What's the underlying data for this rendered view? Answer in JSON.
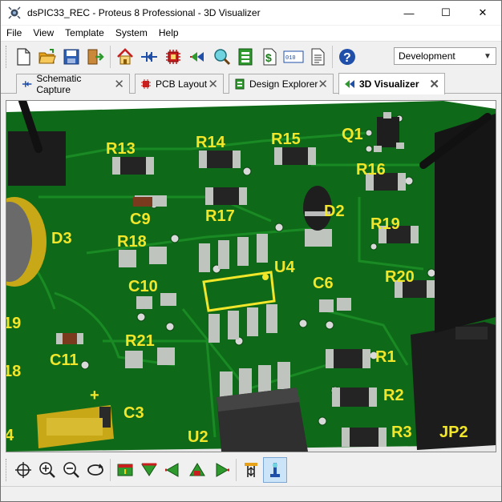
{
  "window": {
    "title": "dsPIC33_REC - Proteus 8 Professional - 3D Visualizer",
    "controls": {
      "minimize": "—",
      "maximize": "☐",
      "close": "✕"
    }
  },
  "menu": [
    "File",
    "View",
    "Template",
    "System",
    "Help"
  ],
  "toolbar": {
    "buttons": [
      "new-file-icon",
      "open-folder-icon",
      "save-icon",
      "close-project-icon",
      "home-icon",
      "schematic-icon",
      "pcb-layout-icon",
      "gerber-icon",
      "design-explorer-icon",
      "bom-icon",
      "cost-icon",
      "vsm-studio-icon",
      "notes-icon",
      "help-icon"
    ],
    "variant_select": "Development"
  },
  "tabs": [
    {
      "label": "Schematic Capture",
      "close": "✕"
    },
    {
      "label": "PCB Layout",
      "close": "✕"
    },
    {
      "label": "Design Explorer",
      "close": "✕"
    },
    {
      "label": "3D Visualizer",
      "close": "✕"
    }
  ],
  "board": {
    "labels": [
      "R13",
      "R14",
      "R15",
      "Q1",
      "R16",
      "R17",
      "D2",
      "C9",
      "D3",
      "R18",
      "U4",
      "R19",
      "C10",
      "C6",
      "R20",
      "R21",
      "C11",
      "R1",
      "R2",
      "C3",
      "R3",
      "JP2",
      "U2",
      "+",
      "19",
      "18",
      "4"
    ],
    "colors": {
      "board": "#0e6a18",
      "silk": "#f2e62a",
      "pad": "#b8bdb8",
      "body": "#2a2a2a"
    }
  },
  "bottom_toolbar": {
    "buttons": [
      "crosshair-icon",
      "zoom-in-icon",
      "zoom-out-icon",
      "rotate-icon",
      "view-top-icon",
      "view-bottom-icon",
      "view-left-icon",
      "view-front-icon",
      "view-right-icon",
      "height-icon",
      "toggle-icon"
    ]
  }
}
